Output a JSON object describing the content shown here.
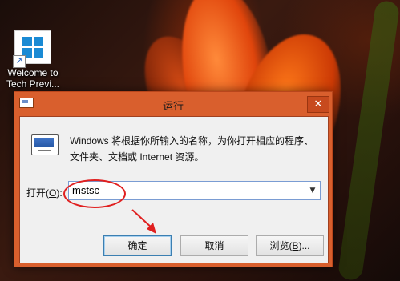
{
  "desktop": {
    "icon_label_line1": "Welcome to",
    "icon_label_line2": "Tech Previ..."
  },
  "dialog": {
    "title": "运行",
    "close_glyph": "✕",
    "description": "Windows 将根据你所输入的名称，为你打开相应的程序、文件夹、文档或 Internet 资源。",
    "open_label_prefix": "打开(",
    "open_label_key": "O",
    "open_label_suffix": "):",
    "input_value": "mstsc",
    "dropdown_glyph": "▼",
    "buttons": {
      "ok": "确定",
      "cancel": "取消",
      "browse_prefix": "浏览(",
      "browse_key": "B",
      "browse_suffix": ")..."
    }
  },
  "colors": {
    "title_bar": "#d95f2d",
    "annotation": "#e02020",
    "windows_blue": "#1a8ad4"
  },
  "icons": [
    "windows-logo-icon",
    "shortcut-arrow-icon",
    "run-app-icon",
    "close-icon",
    "chevron-down-icon"
  ]
}
